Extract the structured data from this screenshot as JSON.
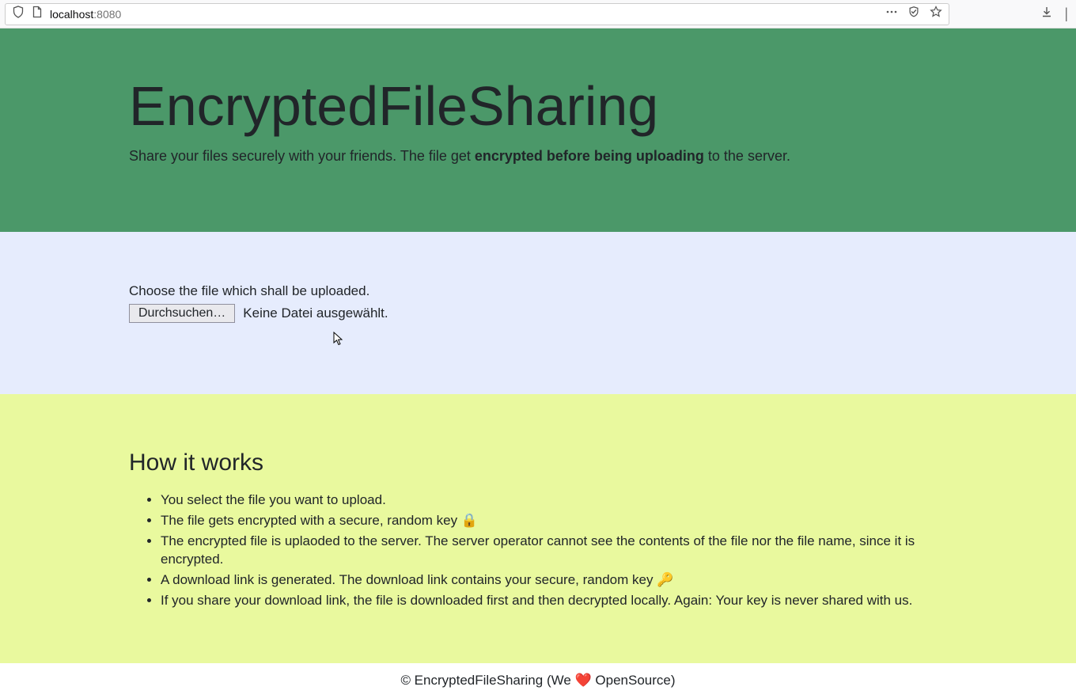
{
  "browser": {
    "url_host": "localhost",
    "url_port": ":8080"
  },
  "header": {
    "title": "EncryptedFileSharing",
    "subtitle_before": "Share your files securely with your friends. The file get ",
    "subtitle_bold": "encrypted before being uploading",
    "subtitle_after": " to the server."
  },
  "upload": {
    "label": "Choose the file which shall be uploaded.",
    "button": "Durchsuchen…",
    "status": "Keine Datei ausgewählt."
  },
  "howitworks": {
    "title": "How it works",
    "items": [
      "You select the file you want to upload.",
      "The file gets encrypted with a secure, random key 🔒",
      "The encrypted file is uplaoded to the server. The server operator cannot see the contents of the file nor the file name, since it is encrypted.",
      "A download link is generated. The download link contains your secure, random key 🔑",
      "If you share your download link, the file is downloaded first and then decrypted locally. Again: Your key is never shared with us."
    ]
  },
  "footer": {
    "before": "© EncryptedFileSharing (We ",
    "heart": "❤️",
    "after": " OpenSource)"
  }
}
